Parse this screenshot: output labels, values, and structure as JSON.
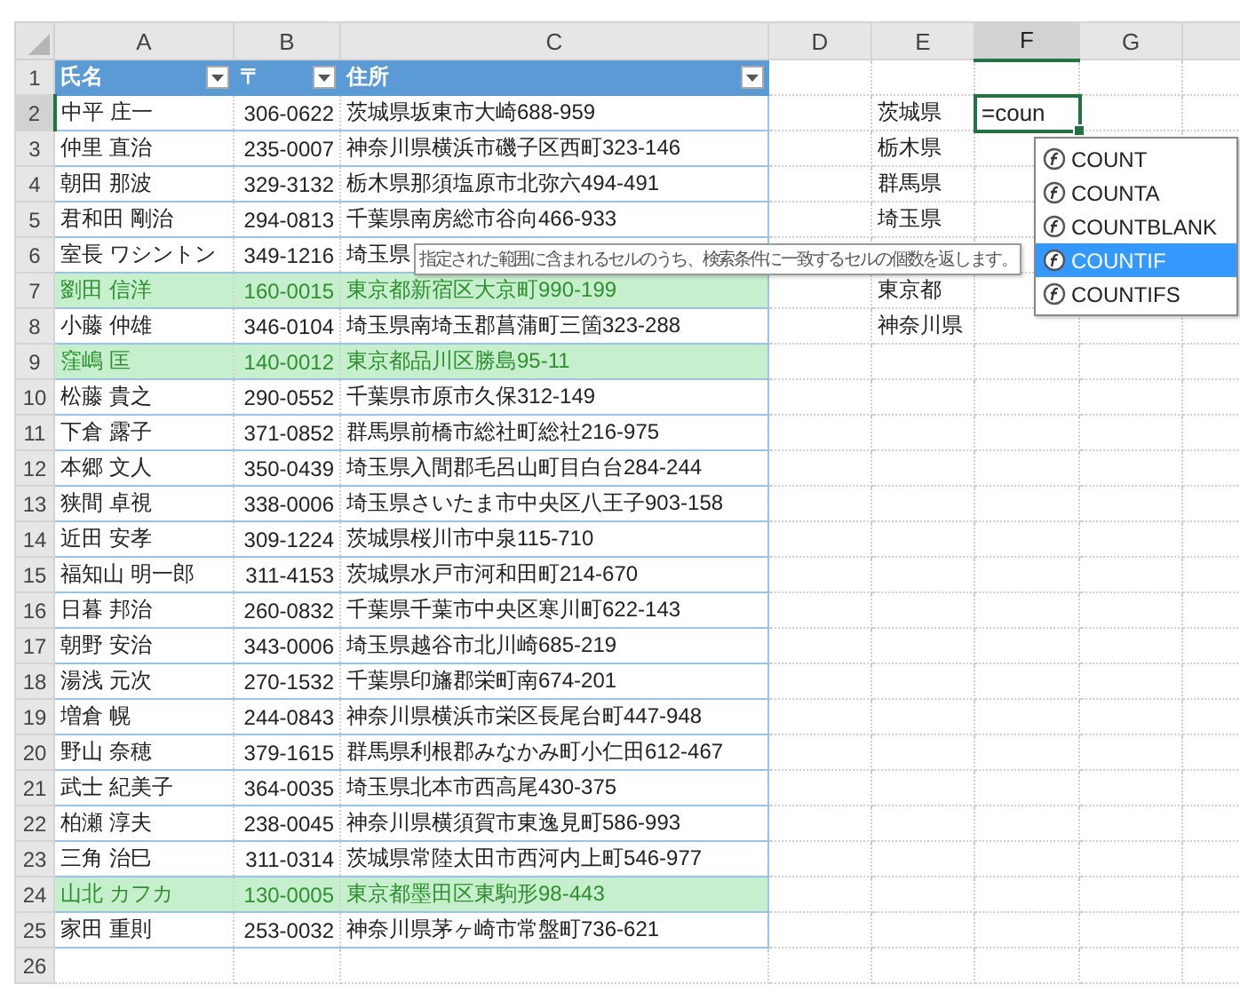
{
  "column_headers": [
    {
      "label": "A",
      "selected": false
    },
    {
      "label": "B",
      "selected": false
    },
    {
      "label": "C",
      "selected": false
    },
    {
      "label": "D",
      "selected": false
    },
    {
      "label": "E",
      "selected": false
    },
    {
      "label": "F",
      "selected": true
    },
    {
      "label": "G",
      "selected": false
    }
  ],
  "table": {
    "header_number": "1",
    "columns": [
      {
        "label": "氏名"
      },
      {
        "label": "〒"
      },
      {
        "label": "住所"
      }
    ]
  },
  "rows": [
    {
      "number": "2",
      "selected": true,
      "name": "中平 庄一",
      "zip": "306-0622",
      "address": "茨城県坂東市大崎688-959",
      "highlighted": false,
      "column_e": "茨城県",
      "column_f": "=coun"
    },
    {
      "number": "3",
      "selected": false,
      "name": "仲里 直治",
      "zip": "235-0007",
      "address": "神奈川県横浜市磯子区西町323-146",
      "highlighted": false,
      "column_e": "栃木県"
    },
    {
      "number": "4",
      "selected": false,
      "name": "朝田 那波",
      "zip": "329-3132",
      "address": "栃木県那須塩原市北弥六494-491",
      "highlighted": false,
      "column_e": "群馬県"
    },
    {
      "number": "5",
      "selected": false,
      "name": "君和田 剛治",
      "zip": "294-0813",
      "address": "千葉県南房総市谷向466-933",
      "highlighted": false,
      "column_e": "埼玉県"
    },
    {
      "number": "6",
      "selected": false,
      "name": "室長 ワシントン",
      "zip": "349-1216",
      "address": "埼玉県",
      "highlighted": false
    },
    {
      "number": "7",
      "selected": false,
      "name": "劉田 信洋",
      "zip": "160-0015",
      "address": "東京都新宿区大京町990-199",
      "highlighted": true,
      "column_e": "東京都"
    },
    {
      "number": "8",
      "selected": false,
      "name": "小藤 仲雄",
      "zip": "346-0104",
      "address": "埼玉県南埼玉郡菖蒲町三箇323-288",
      "highlighted": false,
      "column_e": "神奈川県"
    },
    {
      "number": "9",
      "selected": false,
      "name": "窪嶋 匡",
      "zip": "140-0012",
      "address": "東京都品川区勝島95-11",
      "highlighted": true
    },
    {
      "number": "10",
      "selected": false,
      "name": "松藤 貴之",
      "zip": "290-0552",
      "address": "千葉県市原市久保312-149",
      "highlighted": false
    },
    {
      "number": "11",
      "selected": false,
      "name": "下倉 露子",
      "zip": "371-0852",
      "address": "群馬県前橋市総社町総社216-975",
      "highlighted": false
    },
    {
      "number": "12",
      "selected": false,
      "name": "本郷 文人",
      "zip": "350-0439",
      "address": "埼玉県入間郡毛呂山町目白台284-244",
      "highlighted": false
    },
    {
      "number": "13",
      "selected": false,
      "name": "狭間 卓視",
      "zip": "338-0006",
      "address": "埼玉県さいたま市中央区八王子903-158",
      "highlighted": false
    },
    {
      "number": "14",
      "selected": false,
      "name": "近田 安孝",
      "zip": "309-1224",
      "address": "茨城県桜川市中泉115-710",
      "highlighted": false
    },
    {
      "number": "15",
      "selected": false,
      "name": "福知山 明一郎",
      "zip": "311-4153",
      "address": "茨城県水戸市河和田町214-670",
      "highlighted": false
    },
    {
      "number": "16",
      "selected": false,
      "name": "日暮 邦治",
      "zip": "260-0832",
      "address": "千葉県千葉市中央区寒川町622-143",
      "highlighted": false
    },
    {
      "number": "17",
      "selected": false,
      "name": "朝野 安治",
      "zip": "343-0006",
      "address": "埼玉県越谷市北川崎685-219",
      "highlighted": false
    },
    {
      "number": "18",
      "selected": false,
      "name": "湯浅 元次",
      "zip": "270-1532",
      "address": "千葉県印旛郡栄町南674-201",
      "highlighted": false
    },
    {
      "number": "19",
      "selected": false,
      "name": "増倉 幌",
      "zip": "244-0843",
      "address": "神奈川県横浜市栄区長尾台町447-948",
      "highlighted": false
    },
    {
      "number": "20",
      "selected": false,
      "name": "野山 奈穂",
      "zip": "379-1615",
      "address": "群馬県利根郡みなかみ町小仁田612-467",
      "highlighted": false
    },
    {
      "number": "21",
      "selected": false,
      "name": "武士 紀美子",
      "zip": "364-0035",
      "address": "埼玉県北本市西高尾430-375",
      "highlighted": false
    },
    {
      "number": "22",
      "selected": false,
      "name": "柏瀬 淳夫",
      "zip": "238-0045",
      "address": "神奈川県横須賀市東逸見町586-993",
      "highlighted": false
    },
    {
      "number": "23",
      "selected": false,
      "name": "三角 治巳",
      "zip": "311-0314",
      "address": "茨城県常陸太田市西河内上町546-977",
      "highlighted": false
    },
    {
      "number": "24",
      "selected": false,
      "name": "山北 カフカ",
      "zip": "130-0005",
      "address": "東京都墨田区東駒形98-443",
      "highlighted": true
    },
    {
      "number": "25",
      "selected": false,
      "name": "家田 重則",
      "zip": "253-0032",
      "address": "神奈川県茅ヶ崎市常盤町736-621",
      "highlighted": false
    }
  ],
  "empty_rows": [
    {
      "number": "26",
      "selected": false
    }
  ],
  "autocomplete": {
    "items": [
      {
        "label": "COUNT",
        "selected": false
      },
      {
        "label": "COUNTA",
        "selected": false
      },
      {
        "label": "COUNTBLANK",
        "selected": false
      },
      {
        "label": "COUNTIF",
        "selected": true
      },
      {
        "label": "COUNTIFS",
        "selected": false
      }
    ]
  },
  "tooltip": {
    "text": "指定された範囲に含まれるセルのうち、検索条件に一致するセルの個数を返します。"
  }
}
